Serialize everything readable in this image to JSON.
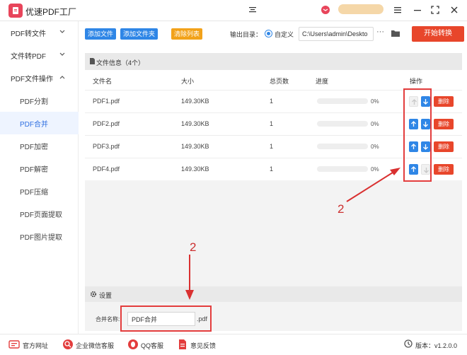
{
  "app": {
    "title": "优速PDF工厂",
    "center_glyph": "—"
  },
  "window_controls": [
    "mail-icon",
    "user-avatar-icon",
    "menu-icon",
    "minimize-icon",
    "maximize-icon",
    "close-icon"
  ],
  "sidebar": {
    "groups": [
      {
        "label": "PDF转文件",
        "expanded": false
      },
      {
        "label": "文件转PDF",
        "expanded": false
      },
      {
        "label": "PDF文件操作",
        "expanded": true
      }
    ],
    "items": [
      {
        "label": "PDF分割",
        "active": false
      },
      {
        "label": "PDF合并",
        "active": true
      },
      {
        "label": "PDF加密",
        "active": false
      },
      {
        "label": "PDF解密",
        "active": false
      },
      {
        "label": "PDF压缩",
        "active": false
      },
      {
        "label": "PDF页面提取",
        "active": false
      },
      {
        "label": "PDF图片提取",
        "active": false
      }
    ]
  },
  "toolbar": {
    "add_file": "添加文件",
    "add_folder": "添加文件夹",
    "clear_list": "清除列表",
    "output_label": "输出目录：",
    "custom_label": "自定义",
    "output_path": "C:\\Users\\admin\\Deskto",
    "more": "···",
    "start": "开始转换"
  },
  "file_info": {
    "title": "文件信息（4个）"
  },
  "table": {
    "headers": {
      "name": "文件名",
      "size": "大小",
      "pages": "总页数",
      "progress": "进度",
      "actions": "操作"
    },
    "rows": [
      {
        "name": "PDF1.pdf",
        "size": "149.30KB",
        "pages": "1",
        "progress": 0,
        "progress_text": "0%",
        "up_enabled": false,
        "down_enabled": true
      },
      {
        "name": "PDF2.pdf",
        "size": "149.30KB",
        "pages": "1",
        "progress": 0,
        "progress_text": "0%",
        "up_enabled": true,
        "down_enabled": true
      },
      {
        "name": "PDF3.pdf",
        "size": "149.30KB",
        "pages": "1",
        "progress": 0,
        "progress_text": "0%",
        "up_enabled": true,
        "down_enabled": true
      },
      {
        "name": "PDF4.pdf",
        "size": "149.30KB",
        "pages": "1",
        "progress": 0,
        "progress_text": "0%",
        "up_enabled": true,
        "down_enabled": false
      }
    ],
    "delete_label": "删除"
  },
  "annotations": {
    "number_1": "2",
    "number_2": "2",
    "color": "#d93030"
  },
  "settings": {
    "title": "设置",
    "merge_label": "合并名称:",
    "merge_value": "PDF合并",
    "merge_ext": ".pdf"
  },
  "footer": {
    "website": "官方网址",
    "wechat": "企业微信客服",
    "qq": "QQ客服",
    "feedback": "意见反馈",
    "version": "版本：v1.2.0.0"
  },
  "colors": {
    "accent": "#2f86e6",
    "danger": "#e8462b",
    "warning": "#f2a21a",
    "brand": "#e8455b"
  }
}
